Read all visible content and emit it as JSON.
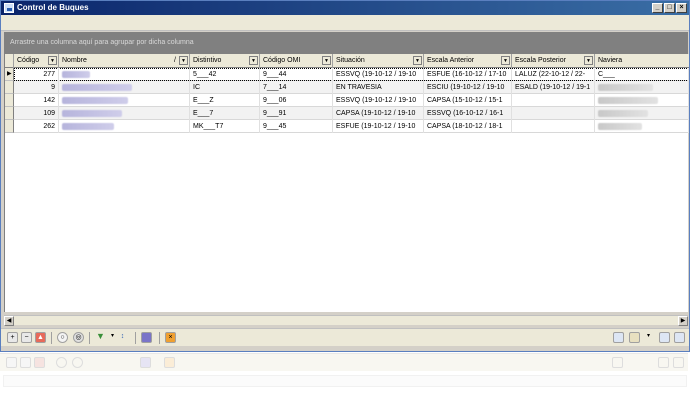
{
  "window": {
    "title": "Control de Buques"
  },
  "groupbar": {
    "hint": "Arrastre una columna aquí para agrupar por dicha columna"
  },
  "columns": [
    {
      "label": "Código"
    },
    {
      "label": "Nombre"
    },
    {
      "label": "Distintivo"
    },
    {
      "label": "Código OMI"
    },
    {
      "label": "Situación"
    },
    {
      "label": "Escala Anterior"
    },
    {
      "label": "Escala Posterior"
    },
    {
      "label": "Naviera"
    }
  ],
  "rows": [
    {
      "codigo": "277",
      "distintivo": "5___42",
      "omi": "9___44",
      "situacion": "ESSVQ  (19-10-12 / 19-10",
      "anterior": "ESFUE  (16-10-12 / 17-10",
      "posterior": "LALUZ  (22-10-12 / 22-",
      "naviera": "C___"
    },
    {
      "codigo": "9",
      "distintivo": "IC",
      "omi": "7___14",
      "situacion": "EN TRAVESIA",
      "anterior": "ESCIU  (19-10-12 / 19-10",
      "posterior": "ESALD  (19-10-12 / 19-1",
      "naviera": ""
    },
    {
      "codigo": "142",
      "distintivo": "E___Z",
      "omi": "9___06",
      "situacion": "ESSVQ  (19-10-12 / 19-10",
      "anterior": "CAPSA  (15-10-12 / 15-1",
      "posterior": "",
      "naviera": ""
    },
    {
      "codigo": "109",
      "distintivo": "E___7",
      "omi": "9___91",
      "situacion": "CAPSA  (19-10-12 / 19-10",
      "anterior": "ESSVQ  (16-10-12 / 16-1",
      "posterior": "",
      "naviera": ""
    },
    {
      "codigo": "262",
      "distintivo": "MK___T7",
      "omi": "9___45",
      "situacion": "ESFUE  (19-10-12 / 19-10",
      "anterior": "CAPSA  (18-10-12 / 18-1",
      "posterior": "",
      "naviera": ""
    }
  ],
  "colors": {
    "groupbar": "#808080",
    "titlebar": "#0a246a",
    "header": "#ece9d8"
  }
}
